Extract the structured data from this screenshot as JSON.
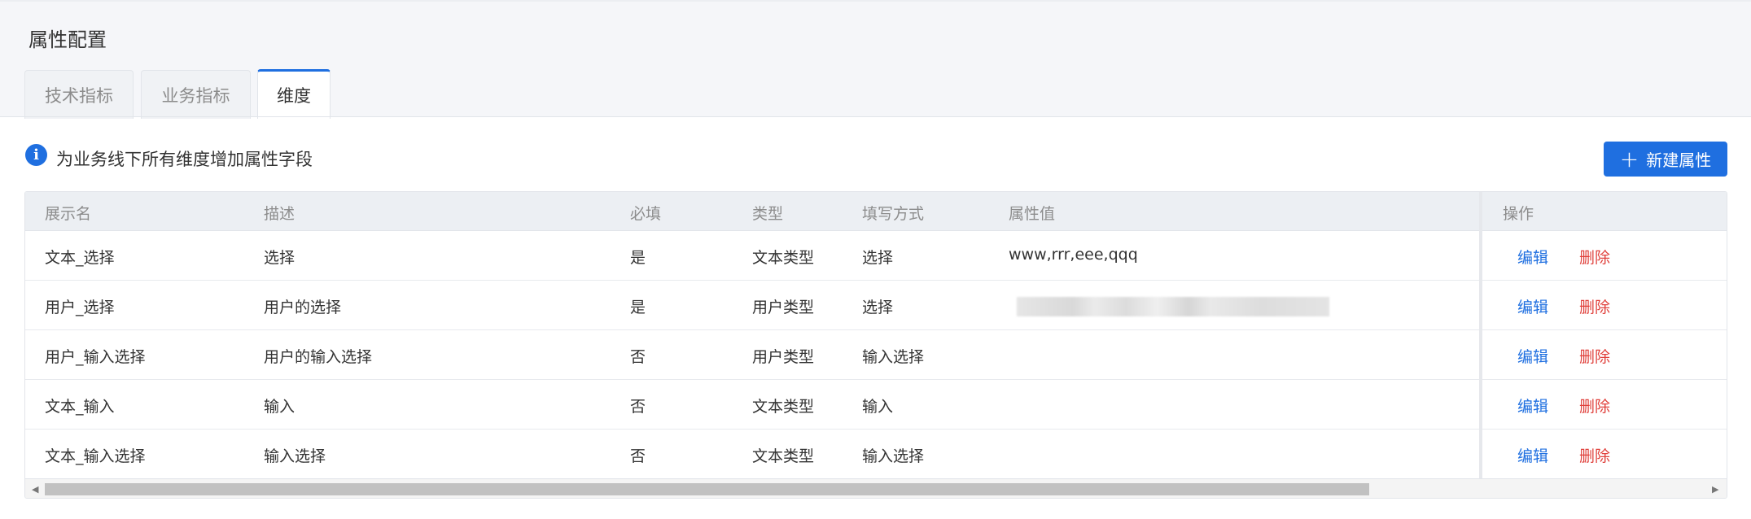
{
  "page": {
    "title": "属性配置"
  },
  "tabs": [
    {
      "label": "技术指标",
      "active": false
    },
    {
      "label": "业务指标",
      "active": false
    },
    {
      "label": "维度",
      "active": true
    }
  ],
  "notice": {
    "icon": "info-icon",
    "text": "为业务线下所有维度增加属性字段"
  },
  "toolbar": {
    "new_label": "新建属性",
    "new_icon": "plus-icon"
  },
  "table": {
    "columns": [
      "展示名",
      "描述",
      "必填",
      "类型",
      "填写方式",
      "属性值",
      "操作"
    ],
    "rows": [
      {
        "name": "文本_选择",
        "desc": "选择",
        "required": "是",
        "type": "文本类型",
        "fill": "选择",
        "value": "www,rrr,eee,qqq"
      },
      {
        "name": "用户_选择",
        "desc": "用户的选择",
        "required": "是",
        "type": "用户类型",
        "fill": "选择",
        "value": ""
      },
      {
        "name": "用户_输入选择",
        "desc": "用户的输入选择",
        "required": "否",
        "type": "用户类型",
        "fill": "输入选择",
        "value": ""
      },
      {
        "name": "文本_输入",
        "desc": "输入",
        "required": "否",
        "type": "文本类型",
        "fill": "输入",
        "value": ""
      },
      {
        "name": "文本_输入选择",
        "desc": "输入选择",
        "required": "否",
        "type": "文本类型",
        "fill": "输入选择",
        "value": ""
      }
    ],
    "actions": {
      "edit": "编辑",
      "delete": "删除"
    }
  },
  "colors": {
    "primary": "#1f6fe0",
    "danger": "#e0403b",
    "header_bg": "#eceff3"
  }
}
